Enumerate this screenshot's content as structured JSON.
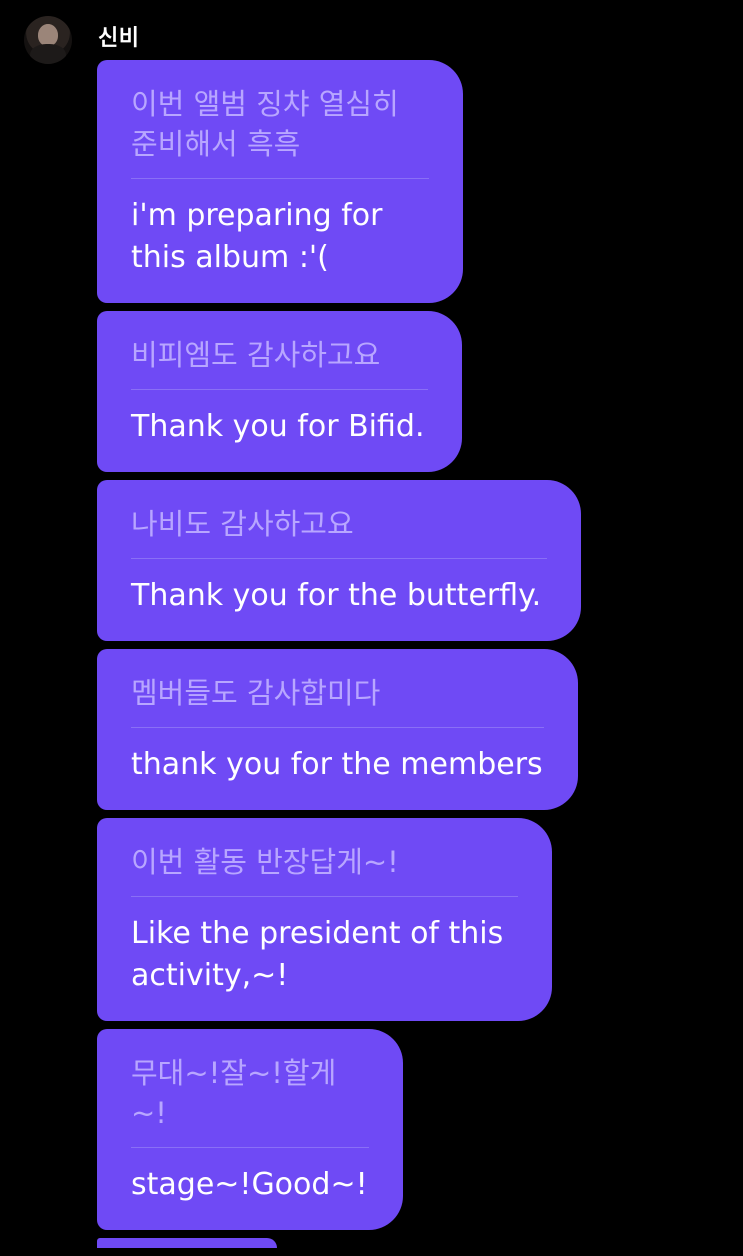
{
  "chat": {
    "sender": {
      "name": "신비"
    },
    "messages": [
      {
        "korean": "이번 앨범 징챠 열심히\n준비해서 흑흑",
        "translation": "i'm preparing for\nthis album :'("
      },
      {
        "korean": "비피엠도 감사하고요",
        "translation": "Thank you for Bifid."
      },
      {
        "korean": "나비도 감사하고요",
        "translation": "Thank you for the butterfly."
      },
      {
        "korean": "멤버들도 감사합미다",
        "translation": "thank you for the members"
      },
      {
        "korean": "이번 활동 반장답게~!",
        "translation": "Like the president of this\nactivity,~!"
      },
      {
        "korean": "무대~!잘~!할게~!",
        "translation": "stage~!Good~!"
      }
    ]
  },
  "colors": {
    "background": "#000000",
    "bubble": "#6f4af5",
    "korean_text": "#b8a6ff",
    "translation_text": "#ffffff"
  }
}
